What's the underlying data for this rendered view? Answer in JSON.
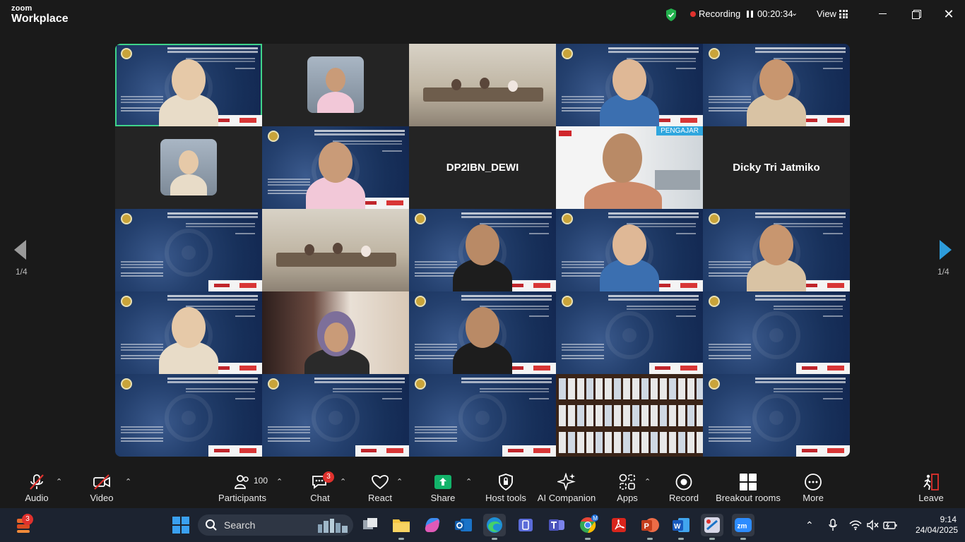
{
  "app": {
    "logo_line1": "zoom",
    "logo_line2": "Workplace",
    "recording_label": "Recording",
    "timer": "00:20:34",
    "view_label": "View"
  },
  "stage": {
    "page_left": "1/4",
    "page_right": "1/4",
    "tiles": [
      {
        "kind": "slide-person",
        "active": true
      },
      {
        "kind": "photo"
      },
      {
        "kind": "room"
      },
      {
        "kind": "slide-person"
      },
      {
        "kind": "slide-person"
      },
      {
        "kind": "photo"
      },
      {
        "kind": "slide-person"
      },
      {
        "kind": "name",
        "name": "DP2IBN_DEWI"
      },
      {
        "kind": "presenter",
        "badge": "PENGAJAR"
      },
      {
        "kind": "name",
        "name": "Dicky Tri Jatmiko"
      },
      {
        "kind": "slide"
      },
      {
        "kind": "room"
      },
      {
        "kind": "slide-person"
      },
      {
        "kind": "slide-person"
      },
      {
        "kind": "slide-person"
      },
      {
        "kind": "slide-person"
      },
      {
        "kind": "person"
      },
      {
        "kind": "slide-person"
      },
      {
        "kind": "slide"
      },
      {
        "kind": "slide"
      },
      {
        "kind": "slide"
      },
      {
        "kind": "slide"
      },
      {
        "kind": "slide"
      },
      {
        "kind": "shelf"
      },
      {
        "kind": "slide"
      }
    ]
  },
  "toolbar": {
    "audio": "Audio",
    "video": "Video",
    "participants": "Participants",
    "participants_count": "100",
    "chat": "Chat",
    "chat_badge": "3",
    "react": "React",
    "share": "Share",
    "host_tools": "Host tools",
    "ai_companion": "AI Companion",
    "apps": "Apps",
    "record": "Record",
    "breakout_rooms": "Breakout rooms",
    "more": "More",
    "leave": "Leave"
  },
  "taskbar": {
    "widget_badge": "3",
    "search_placeholder": "Search",
    "time": "9:14",
    "date": "24/04/2025"
  },
  "colors": {
    "active_border": "#3fd48a",
    "share_green": "#12b36a",
    "leave_red": "#e0312d",
    "nav_blue": "#2d9cdb"
  }
}
